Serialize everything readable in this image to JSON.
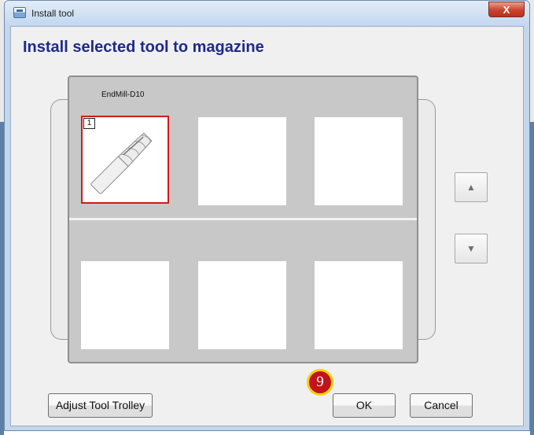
{
  "window": {
    "title": "Install tool",
    "close_label": "X"
  },
  "heading": "Install selected tool to magazine",
  "magazine": {
    "tool_name": "EndMill-D10",
    "slots": [
      {
        "number": "1",
        "selected": true,
        "tool_icon": "end-mill-icon"
      },
      {
        "number": "",
        "selected": false
      },
      {
        "number": "",
        "selected": false
      },
      {
        "number": "",
        "selected": false
      },
      {
        "number": "",
        "selected": false
      },
      {
        "number": "",
        "selected": false
      }
    ],
    "scroll_up_icon": "triangle-up-icon",
    "scroll_down_icon": "triangle-down-icon"
  },
  "buttons": {
    "adjust": "Adjust Tool Trolley",
    "ok": "OK",
    "cancel": "Cancel"
  },
  "step_badge": "9",
  "colors": {
    "heading": "#1e2a8a",
    "selected_border": "#d11a1a",
    "badge_fill": "#c3141c",
    "badge_ring": "#f5d20a"
  }
}
